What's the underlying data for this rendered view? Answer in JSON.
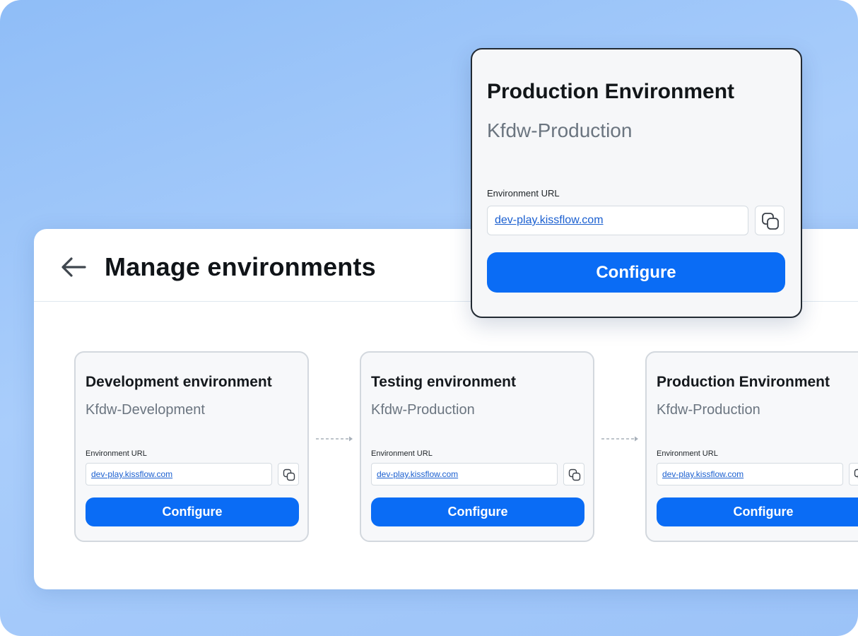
{
  "header": {
    "title": "Manage environments",
    "back_icon": "arrow-left-icon"
  },
  "environments": [
    {
      "title": "Development environment",
      "subtitle": "Kfdw-Development",
      "url_label": "Environment URL",
      "url": "dev-play.kissflow.com",
      "copy_icon": "copy-icon",
      "button_label": "Configure"
    },
    {
      "title": "Testing environment",
      "subtitle": "Kfdw-Production",
      "url_label": "Environment URL",
      "url": "dev-play.kissflow.com",
      "copy_icon": "copy-icon",
      "button_label": "Configure"
    },
    {
      "title": "Production Environment",
      "subtitle": "Kfdw-Production",
      "url_label": "Environment URL",
      "url": "dev-play.kissflow.com",
      "copy_icon": "copy-icon",
      "button_label": "Configure"
    }
  ],
  "popup": {
    "title": "Production Environment",
    "subtitle": "Kfdw-Production",
    "url_label": "Environment URL",
    "url": "dev-play.kissflow.com",
    "copy_icon": "copy-icon",
    "button_label": "Configure"
  },
  "colors": {
    "accent": "#0a6cf5",
    "link": "#1a5fd0",
    "background": "#a9cdfb"
  }
}
